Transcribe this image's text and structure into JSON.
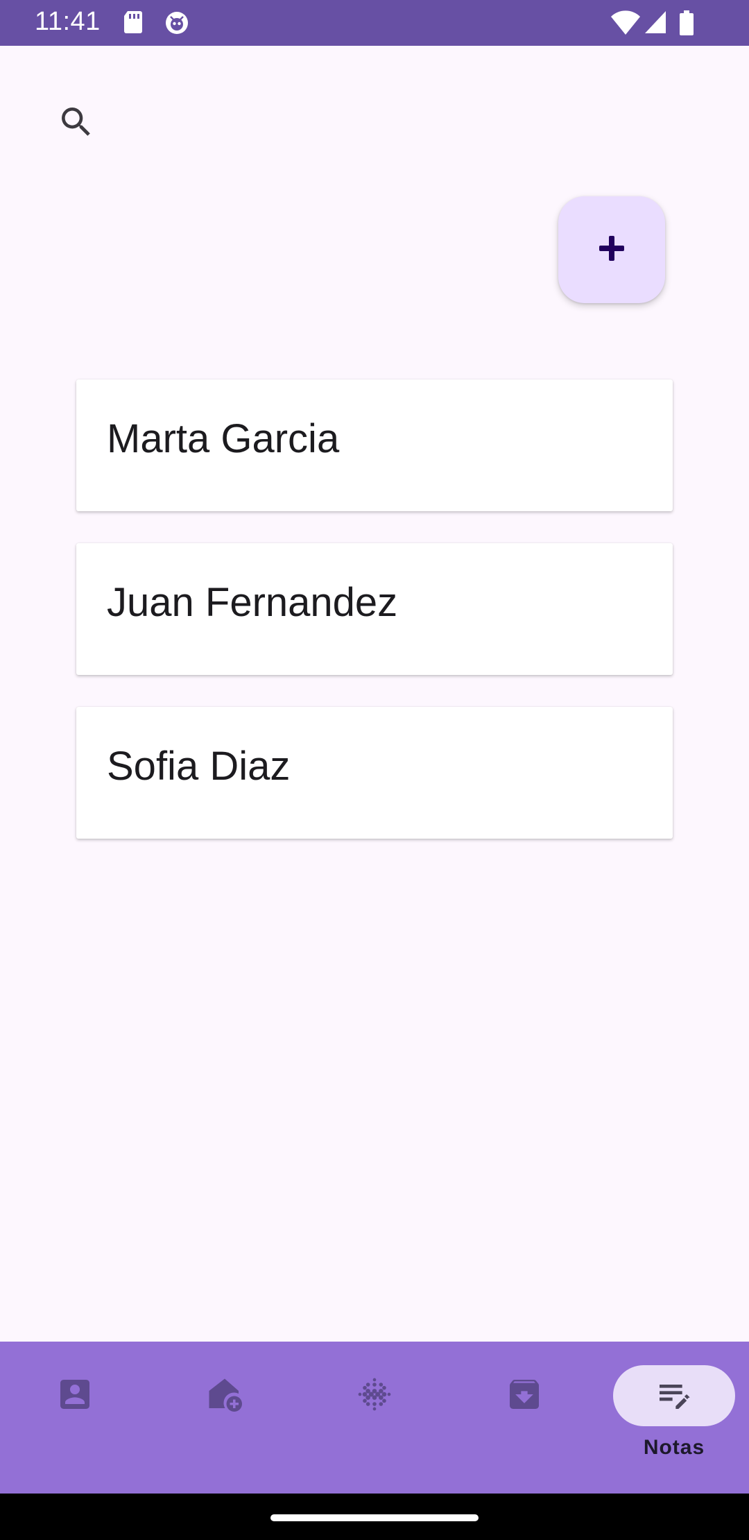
{
  "status_bar": {
    "time": "11:41",
    "icons": [
      "sd-card-icon",
      "debug-icon",
      "wifi-icon",
      "signal-icon",
      "battery-icon"
    ]
  },
  "toolbar": {
    "search_icon": "search-icon",
    "fab_icon": "plus-icon"
  },
  "contacts": [
    {
      "name": "Marta Garcia"
    },
    {
      "name": "Juan Fernandez"
    },
    {
      "name": "Sofia Diaz"
    }
  ],
  "bottom_nav": {
    "items": [
      {
        "icon": "contact-icon",
        "label": ""
      },
      {
        "icon": "add-home-icon",
        "label": ""
      },
      {
        "icon": "dot-grid-icon",
        "label": ""
      },
      {
        "icon": "archive-icon",
        "label": ""
      },
      {
        "icon": "notes-edit-icon",
        "label": "Notas",
        "active": true
      }
    ]
  },
  "colors": {
    "status_bar": "#6750a4",
    "background": "#fdf7fe",
    "fab": "#eaddff",
    "bottom_nav": "#9370d6",
    "active_pill": "#e8def8"
  }
}
